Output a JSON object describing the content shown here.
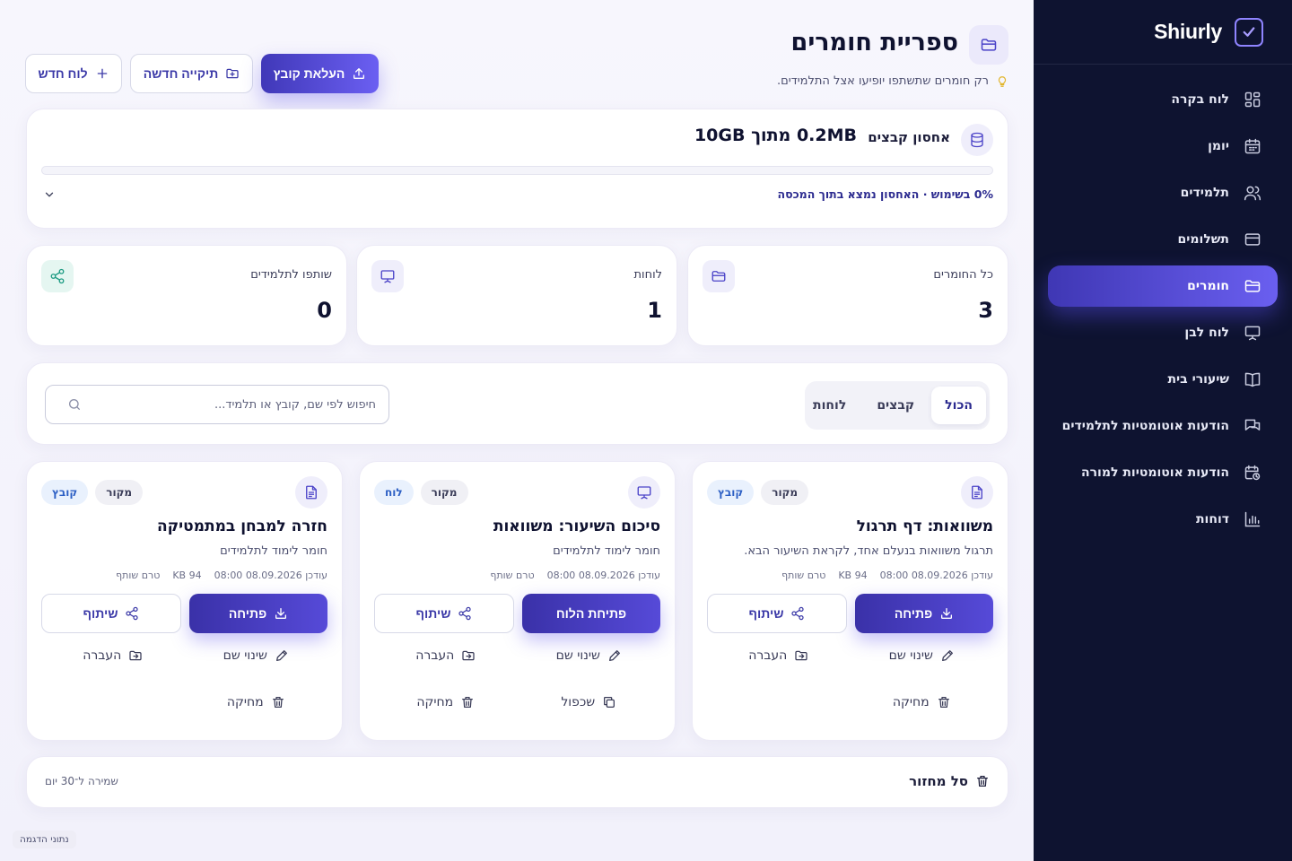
{
  "brand": {
    "name": "Shiurly"
  },
  "sidebar": {
    "items": [
      {
        "label": "לוח בקרה",
        "icon": "grid-icon",
        "active": false
      },
      {
        "label": "יומן",
        "icon": "calendar-icon",
        "active": false
      },
      {
        "label": "תלמידים",
        "icon": "users-icon",
        "active": false
      },
      {
        "label": "תשלומים",
        "icon": "credit-card-icon",
        "active": false
      },
      {
        "label": "חומרים",
        "icon": "folder-icon",
        "active": true
      },
      {
        "label": "לוח לבן",
        "icon": "presentation-icon",
        "active": false
      },
      {
        "label": "שיעורי בית",
        "icon": "book-icon",
        "active": false
      },
      {
        "label": "הודעות אוטומטיות לתלמידים",
        "icon": "chat-icon",
        "active": false
      },
      {
        "label": "הודעות אוטומטיות למורה",
        "icon": "calendar-clock-icon",
        "active": false
      },
      {
        "label": "דוחות",
        "icon": "bar-chart-icon",
        "active": false
      }
    ]
  },
  "header": {
    "title": "ספריית חומרים",
    "subtitle": "רק חומרים שתשתפו יופיעו אצל התלמידים.",
    "actions": {
      "upload": "העלאת קובץ",
      "new_folder": "תיקייה חדשה",
      "new_board": "לוח חדש"
    }
  },
  "storage": {
    "label": "אחסון קבצים",
    "value": "0.2MB מתוך 10GB",
    "used_fraction": 0.0,
    "note": "0% בשימוש · האחסון נמצא בתוך המכסה"
  },
  "stats": [
    {
      "label": "כל החומרים",
      "value": "3",
      "icon": "folder-icon"
    },
    {
      "label": "לוחות",
      "value": "1",
      "icon": "presentation-icon"
    },
    {
      "label": "שותפו לתלמידים",
      "value": "0",
      "icon": "share-icon"
    }
  ],
  "filters": {
    "tabs": [
      "הכול",
      "קבצים",
      "לוחות"
    ],
    "active_tab": "הכול",
    "search_placeholder": "חיפוש לפי שם, קובץ או תלמיד..."
  },
  "materials": [
    {
      "icon": "file-text-icon",
      "type_badge": "קובץ",
      "source_badge": "מקור",
      "title": "משוואות: דף תרגול",
      "description": "תרגול משוואות בנעלם אחד, לקראת השיעור הבא.",
      "updated": "עודכן 08.09.2026 08:00",
      "size": "94 KB",
      "share_state": "טרם שותף",
      "primary_action": "פתיחה",
      "share_action": "שיתוף",
      "links": [
        "שינוי שם",
        "העברה",
        "מחיקה"
      ]
    },
    {
      "icon": "presentation-icon",
      "type_badge": "לוח",
      "source_badge": "מקור",
      "title": "סיכום השיעור: משוואות",
      "description": "חומר לימוד לתלמידים",
      "updated": "עודכן 08.09.2026 08:00",
      "size": "",
      "share_state": "טרם שותף",
      "primary_action": "פתיחת הלוח",
      "share_action": "שיתוף",
      "links": [
        "שינוי שם",
        "העברה",
        "שכפול",
        "מחיקה"
      ]
    },
    {
      "icon": "file-text-icon",
      "type_badge": "קובץ",
      "source_badge": "מקור",
      "title": "חזרה למבחן במתמטיקה",
      "description": "חומר לימוד לתלמידים",
      "updated": "עודכן 08.09.2026 08:00",
      "size": "94 KB",
      "share_state": "טרם שותף",
      "primary_action": "פתיחה",
      "share_action": "שיתוף",
      "links": [
        "שינוי שם",
        "העברה",
        "מחיקה"
      ]
    }
  ],
  "recycle_bin": {
    "title": "סל מחזור",
    "note": "שמירה ל־30 יום"
  },
  "demo_tag": "נתוני הדגמה",
  "colors": {
    "accent": "#5a50e0",
    "sidebar_bg": "#0e1330",
    "teal": "#1f9c84"
  }
}
